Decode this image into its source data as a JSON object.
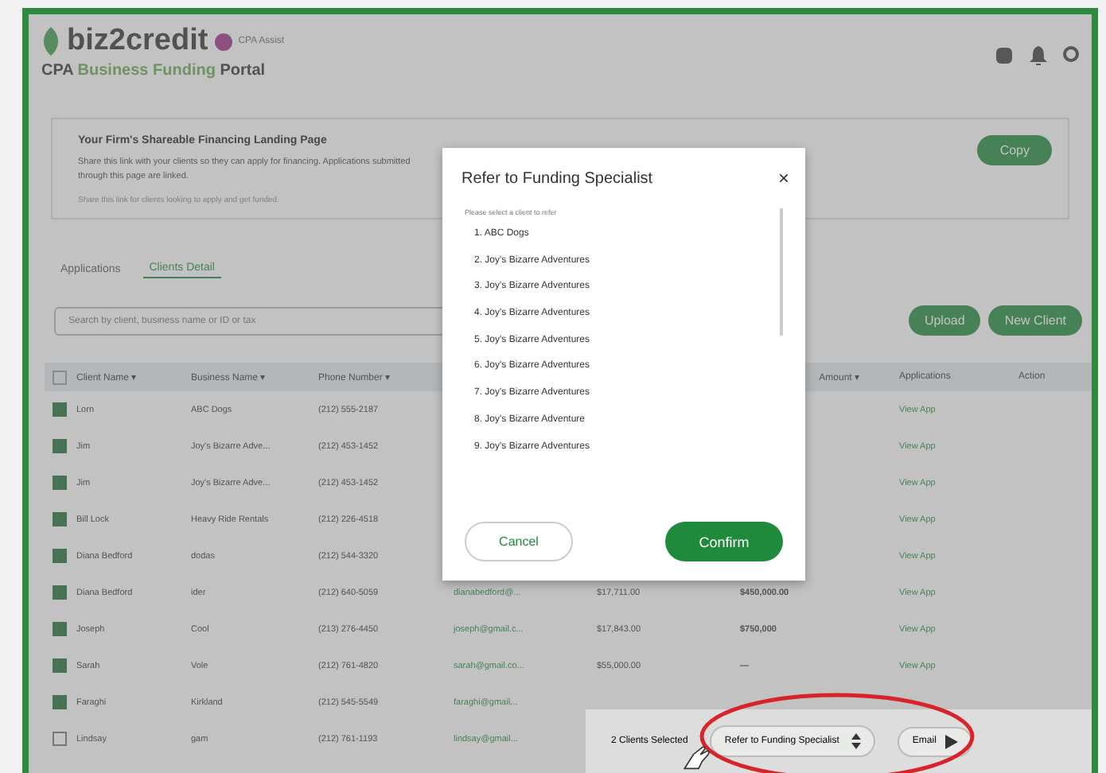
{
  "header": {
    "logo": "biz2credit",
    "logo_badge": "CPA Assist",
    "portal_title_lead": "CPA",
    "portal_title_accent": "Business Funding",
    "portal_title_end": "Portal"
  },
  "landing_card": {
    "title": "Your Firm's Shareable Financing Landing Page",
    "description": "Share this link with your clients so they can apply for financing. Applications submitted through this page are linked.",
    "note": "Share this link for clients looking to apply and get funded.",
    "copy_button": "Copy"
  },
  "tabs": [
    {
      "label": "Applications",
      "selected": false
    },
    {
      "label": "Clients Detail",
      "selected": true
    }
  ],
  "search": {
    "placeholder": "Search by client, business name or ID or tax"
  },
  "actions": [
    "Upload",
    "New Client"
  ],
  "table": {
    "select_all": {
      "checked": false
    },
    "columns": [
      "Client Name ▾",
      "Business Name ▾",
      "Phone Number ▾",
      "Amount ▾",
      "Applications",
      "Action"
    ],
    "rows": [
      {
        "checked": true,
        "client": "Lorn",
        "business": "ABC Dogs",
        "phone": "(212) 555-2187",
        "app": "View App"
      },
      {
        "checked": true,
        "client": "Jim",
        "business": "Joy's Bizarre Adve...",
        "phone": "(212) 453-1452",
        "app": "View App"
      },
      {
        "checked": true,
        "client": "Jim",
        "business": "Joy's Bizarre Adve...",
        "phone": "(212) 453-1452",
        "app": "View App"
      },
      {
        "checked": true,
        "client": "Bill Lock",
        "business": "Heavy Ride Rentals",
        "phone": "(212) 226-4518",
        "app": "View App"
      },
      {
        "checked": true,
        "client": "Diana Bedford",
        "business": "dodas",
        "phone": "(212) 544-3320",
        "app": "View App"
      },
      {
        "checked": true,
        "client": "Diana Bedford",
        "business": "ider",
        "phone": "(212) 640-5059",
        "email": "dianabedford@...",
        "revenue": "$17,711.00",
        "amount": "$450,000.00",
        "app": "View App"
      },
      {
        "checked": true,
        "client": "Joseph",
        "business": "Cool",
        "phone": "(213) 276-4450",
        "email": "joseph@gmail.c...",
        "revenue": "$17,843.00",
        "amount": "$750,000",
        "app": "View App"
      },
      {
        "checked": true,
        "client": "Sarah",
        "business": "Vole",
        "phone": "(212) 761-4820",
        "email": "sarah@gmail.co...",
        "revenue": "$55,000.00",
        "amount": "—",
        "app": "View App"
      },
      {
        "checked": true,
        "client": "Faraghi",
        "business": "Kirkland",
        "phone": "(212) 545-5549",
        "email": "faraghi@gmail..."
      },
      {
        "checked": false,
        "client": "Lindsay",
        "business": "gam",
        "phone": "(212) 761-1193",
        "email": "lindsay@gmail..."
      }
    ]
  },
  "modal": {
    "title": "Refer to Funding Specialist",
    "close": "×",
    "subtitle": "Please select a client to refer",
    "items": [
      "1. ABC Dogs",
      "2. Joy's Bizarre Adventures",
      "3. Joy's Bizarre Adventures",
      "4. Joy's Bizarre Adventures",
      "5. Joy's Bizarre Adventures",
      "6. Joy's Bizarre Adventures",
      "7. Joy's Bizarre Adventures",
      "8. Joy's Bizarre Adventure",
      "9. Joy's Bizarre Adventures"
    ],
    "cancel": "Cancel",
    "confirm": "Confirm"
  },
  "bulk_bar": {
    "count": "2 Clients Selected",
    "action": "Refer to Funding Specialist",
    "email": "Email"
  }
}
